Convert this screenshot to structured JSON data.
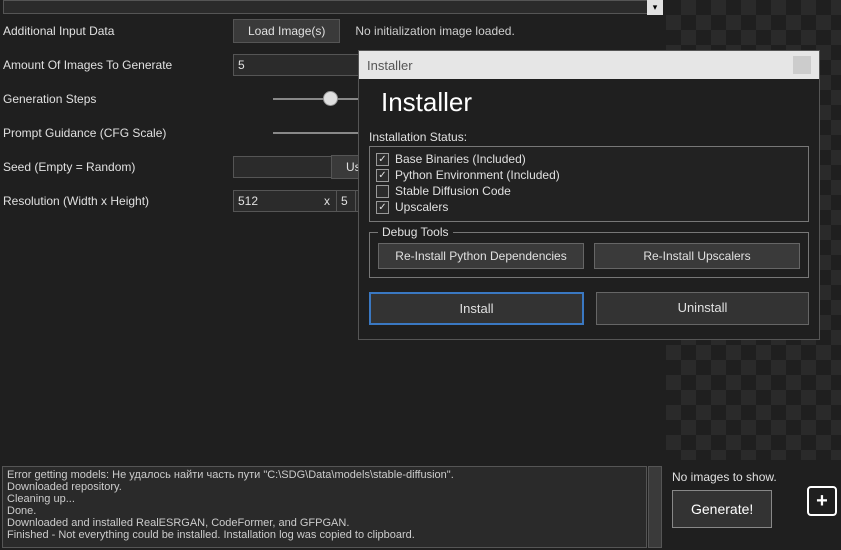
{
  "labels": {
    "additional_input": "Additional Input Data",
    "amount_images": "Amount Of Images To Generate",
    "gen_steps": "Generation Steps",
    "cfg_scale": "Prompt Guidance (CFG Scale)",
    "seed": "Seed (Empty = Random)",
    "resolution": "Resolution (Width x Height)"
  },
  "buttons": {
    "load_images": "Load Image(s)",
    "use": "Us",
    "generate": "Generate!"
  },
  "values": {
    "amount_images": "5",
    "seed": "",
    "res_w": "512",
    "res_h": "5",
    "res_sep": "x"
  },
  "notes": {
    "no_init": "No initialization image loaded.",
    "no_images_show": "No images to show."
  },
  "installer": {
    "window_title": "Installer",
    "heading": "Installer",
    "status_label": "Installation Status:",
    "items": [
      {
        "label": "Base Binaries (Included)",
        "checked": true
      },
      {
        "label": "Python Environment (Included)",
        "checked": true
      },
      {
        "label": "Stable Diffusion Code",
        "checked": false
      },
      {
        "label": "Upscalers",
        "checked": true
      }
    ],
    "debug_legend": "Debug Tools",
    "reinstall_py": "Re-Install Python Dependencies",
    "reinstall_up": "Re-Install Upscalers",
    "install": "Install",
    "uninstall": "Uninstall"
  },
  "log_lines": [
    "Error getting models: Не удалось найти часть пути \"C:\\SDG\\Data\\models\\stable-diffusion\".",
    "Downloaded repository.",
    "Cleaning up...",
    "Done.",
    "Downloaded and installed RealESRGAN, CodeFormer, and GFPGAN.",
    "Finished - Not everything could be installed. Installation log was copied to clipboard."
  ]
}
